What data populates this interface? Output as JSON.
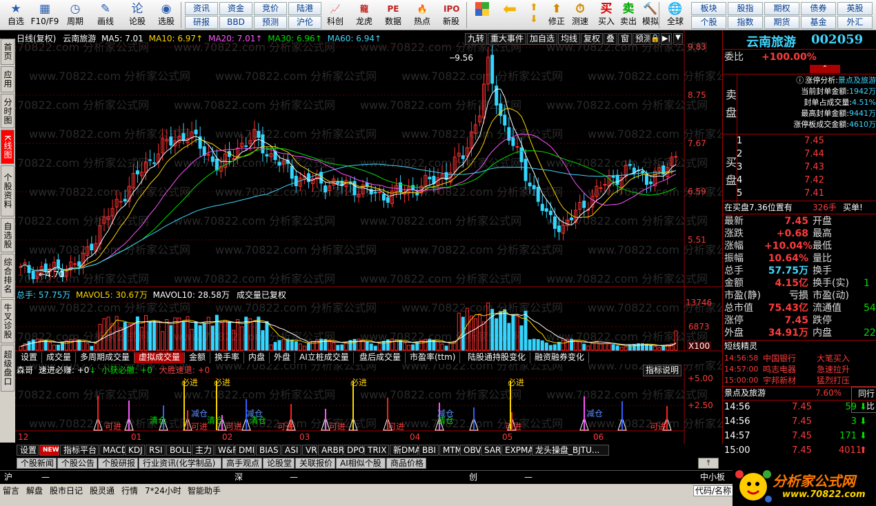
{
  "toolbar": {
    "buttons": [
      {
        "label": "自选",
        "icon": "star-icon"
      },
      {
        "label": "F10/F9",
        "icon": "window-icon"
      },
      {
        "label": "周期",
        "icon": "clock-icon"
      },
      {
        "label": "画线",
        "icon": "pencil-icon"
      },
      {
        "label": "论股",
        "icon": "lun-icon"
      },
      {
        "label": "选股",
        "icon": "radar-icon"
      }
    ],
    "grid": [
      [
        "资讯",
        "资金",
        "竞价",
        "陆港"
      ],
      [
        "研报",
        "BBD",
        "预测",
        "沪伦"
      ]
    ],
    "buttons2": [
      {
        "label": "科创",
        "icon": "chart-icon"
      },
      {
        "label": "龙虎",
        "icon": "dragon-icon"
      },
      {
        "label": "数据",
        "icon": "pe-icon"
      },
      {
        "label": "热点",
        "icon": "fire-icon"
      },
      {
        "label": "新股",
        "icon": "ipo-icon"
      }
    ],
    "buttons3": [
      {
        "label": "修正",
        "icon": "up-arrow-icon"
      },
      {
        "label": "测速",
        "icon": "stopwatch-icon"
      },
      {
        "label": "买入",
        "icon": "buy-icon",
        "glyph": "买"
      },
      {
        "label": "卖出",
        "icon": "sell-icon",
        "glyph": "卖"
      },
      {
        "label": "模拟",
        "icon": "hammer-icon"
      },
      {
        "label": "全球",
        "icon": "globe-icon"
      }
    ],
    "grid2": [
      [
        "板块",
        "股指",
        "期权",
        "债券",
        "英股"
      ],
      [
        "个股",
        "指数",
        "期货",
        "基金",
        "外汇"
      ]
    ]
  },
  "left_tabs": [
    {
      "label": "首页",
      "active": false
    },
    {
      "label": "应用",
      "active": false
    },
    {
      "label": "分时图",
      "active": false
    },
    {
      "label": "K线图",
      "active": true
    },
    {
      "label": "个股资料",
      "active": false
    },
    {
      "label": "自选股",
      "active": false
    },
    {
      "label": "综合排名",
      "active": false
    },
    {
      "label": "牛叉诊股",
      "active": false
    },
    {
      "label": "超级盘口",
      "active": false
    }
  ],
  "chart": {
    "header": {
      "period": "日线(复权)",
      "name": "云南旅游",
      "ma5": "MA5: 7.01",
      "ma10": "MA10: 6.97",
      "ma20": "MA20: 7.01",
      "ma30": "MA30: 6.96",
      "ma60": "MA60: 6.94"
    },
    "top_buttons": [
      "九转",
      "重大事件",
      "加自选",
      "均线",
      "复权",
      "叠",
      "窗",
      "预测"
    ],
    "price_axis": [
      "9.83",
      "8.75",
      "7.67",
      "6.59",
      "5.51"
    ],
    "annotations": {
      "high": "9.56",
      "low": "4.70"
    },
    "watermark": "www.70822.com 分析家公式网",
    "volume_header": {
      "total": "总手: 57.75万",
      "mavol5": "MAVOL5: 30.67万",
      "mavol10": "MAVOL10: 28.58万",
      "note": "成交量已复权"
    },
    "volume_axis": [
      "13746",
      "6873"
    ],
    "volume_unit": "X100",
    "sub_tabs": [
      "设置",
      "成交量",
      "多周期成交量",
      "虚拟成交量",
      "金额",
      "换手率",
      "内盘",
      "外盘",
      "AI立桩成交量",
      "盘后成交量",
      "市盈率(ttm)",
      "陆股通持股变化",
      "融资融券变化"
    ],
    "active_sub_tab": "虚拟成交量",
    "indicator_header": {
      "name": "森哥",
      "v1": "速进必赚: +0",
      "v2": "小获必撤: +0",
      "v3": "大胜速退: +0"
    },
    "indicator_help": "指标说明",
    "indicator_axis": [
      "+5.00",
      "+2.50"
    ],
    "months": [
      "12",
      "01",
      "02",
      "03",
      "04",
      "05",
      "06"
    ],
    "signals": {
      "buy": "必进",
      "in": "可进",
      "clear": "清仓",
      "reduce": "减仓"
    }
  },
  "right_panel": {
    "title": "云南旅游",
    "code": "002059",
    "weibi_label": "委比",
    "weibi_value": "+100.00%",
    "limit_info": [
      {
        "label": "涨停分析:",
        "value": "景点及旅游"
      },
      {
        "label": "当前封单金额:",
        "value": "1942万"
      },
      {
        "label": "封单占成交量:",
        "value": "4.51%"
      },
      {
        "label": "最高封单金额:",
        "value": "9441万"
      },
      {
        "label": "涨停板成交金额:",
        "value": "4610万"
      }
    ],
    "sell_label": "卖盘",
    "buy_label": "买盘",
    "bids": [
      {
        "level": "1",
        "price": "7.45"
      },
      {
        "level": "2",
        "price": "7.44"
      },
      {
        "level": "3",
        "price": "7.43"
      },
      {
        "level": "4",
        "price": "7.42"
      },
      {
        "level": "5",
        "price": "7.41"
      }
    ],
    "bid_position": "在买盘7.36位置有",
    "bid_position_qty": "326手",
    "bid_position_action": "买单!",
    "quote_left": [
      {
        "label": "最新",
        "value": "7.45"
      },
      {
        "label": "涨跌",
        "value": "+0.68"
      },
      {
        "label": "涨幅",
        "value": "+10.04%"
      },
      {
        "label": "振幅",
        "value": "10.64%"
      },
      {
        "label": "总手",
        "value": "57.75万"
      },
      {
        "label": "金额",
        "value": "4.15亿"
      },
      {
        "label": "市盈(静)",
        "value": "亏损"
      },
      {
        "label": "总市值",
        "value": "75.43亿"
      },
      {
        "label": "涨停",
        "value": "7.45"
      },
      {
        "label": "外盘",
        "value": "34.91万"
      }
    ],
    "quote_right": [
      {
        "label": "开盘",
        "value": ""
      },
      {
        "label": "最高",
        "value": ""
      },
      {
        "label": "最低",
        "value": ""
      },
      {
        "label": "量比",
        "value": ""
      },
      {
        "label": "换手",
        "value": ""
      },
      {
        "label": "换手(实)",
        "value": "1"
      },
      {
        "label": "市盈(动)",
        "value": ""
      },
      {
        "label": "流通值",
        "value": "54"
      },
      {
        "label": "跌停",
        "value": ""
      },
      {
        "label": "内盘",
        "value": "22"
      }
    ],
    "short_title": "短线精灵",
    "short_items": [
      {
        "time": "14:56:58",
        "name": "中国银行",
        "action": "大笔买入"
      },
      {
        "time": "14:57:00",
        "name": "鸣志电器",
        "action": "急速拉升"
      },
      {
        "time": "15:00:00",
        "name": "宇邦新材",
        "action": "猛烈打压"
      }
    ],
    "sector_name": "景点及旅游",
    "sector_pct": "7.60%",
    "sector_btn": "同行比",
    "ticks": [
      {
        "time": "14:56",
        "price": "7.45",
        "vol": "59",
        "dir": "down"
      },
      {
        "time": "14:56",
        "price": "7.45",
        "vol": "3",
        "dir": "down"
      },
      {
        "time": "14:57",
        "price": "7.45",
        "vol": "171",
        "dir": "down"
      },
      {
        "time": "15:00",
        "price": "7.45",
        "vol": "4011",
        "dir": "up"
      }
    ]
  },
  "indicator_tabs": [
    "设置",
    "NEW",
    "指标平台",
    "MACD",
    "KDJ",
    "RSI",
    "BOLL",
    "主力",
    "W&R",
    "DMI",
    "BIAS",
    "ASI",
    "VR",
    "ARBR",
    "DPO",
    "TRIX",
    "新DMA",
    "BBI",
    "MTM",
    "OBV",
    "SAR",
    "EXPMA",
    "龙头操盘_BJTU..."
  ],
  "news_tabs": [
    "个股新闻",
    "个股公告",
    "个股研报",
    "行业资讯(化学制品)",
    "高手观点",
    "论股堂",
    "关联报价",
    "AI相似个股",
    "商品价格"
  ],
  "index_bar": {
    "sh": "沪",
    "sz": "深",
    "cy": "创",
    "small": "中小板"
  },
  "status_bar": [
    "留言",
    "解盘",
    "股市日记",
    "股灵通",
    "行情",
    "7*24小时",
    "智能助手"
  ],
  "code_label": "代码/名称",
  "logo": {
    "text": "分析家公式网",
    "url": "www.70822.com"
  }
}
